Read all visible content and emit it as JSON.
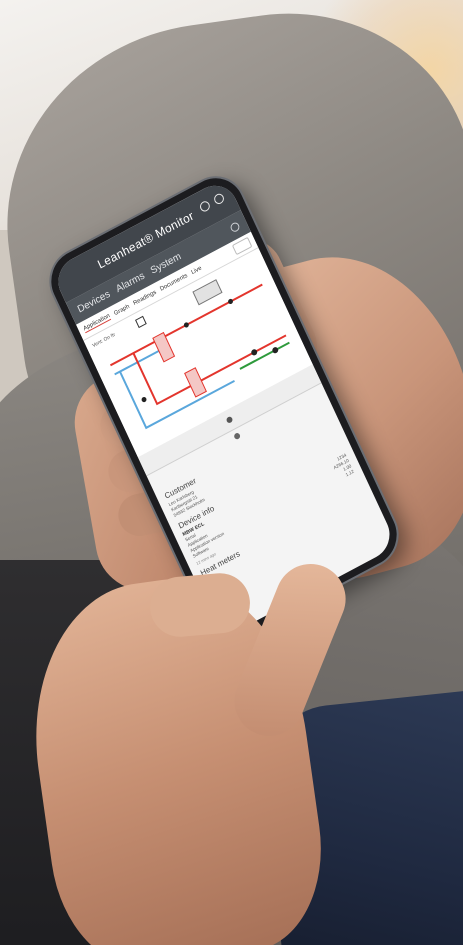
{
  "app": {
    "title": "Leanheat® Monitor",
    "nav_tabs": [
      "Devices",
      "Alarms",
      "System"
    ],
    "sub_tabs": [
      "Application",
      "Graph",
      "Readings",
      "Documents",
      "Live"
    ],
    "diagram_label": "Vent: On ftr"
  },
  "customer": {
    "heading": "Customer",
    "rows": [
      "Leo Karlsberg",
      "Karlbergsät 21",
      "54932 Stockholm"
    ]
  },
  "device_info": {
    "heading": "Device info",
    "model": "MBW ECL",
    "rows": [
      {
        "label": "Serial",
        "value": "1234"
      },
      {
        "label": "Application",
        "value": "A266.10"
      },
      {
        "label": "Application version",
        "value": "1.00"
      },
      {
        "label": "Software",
        "value": "1.12"
      }
    ],
    "footer": "12 mins ago"
  },
  "heat_meters": {
    "heading": "Heat meters"
  },
  "colors": {
    "app_bar": "#41464c",
    "supply_line": "#e3352d",
    "return_line": "#5aa7dc",
    "status_line": "#2e9a3c"
  }
}
